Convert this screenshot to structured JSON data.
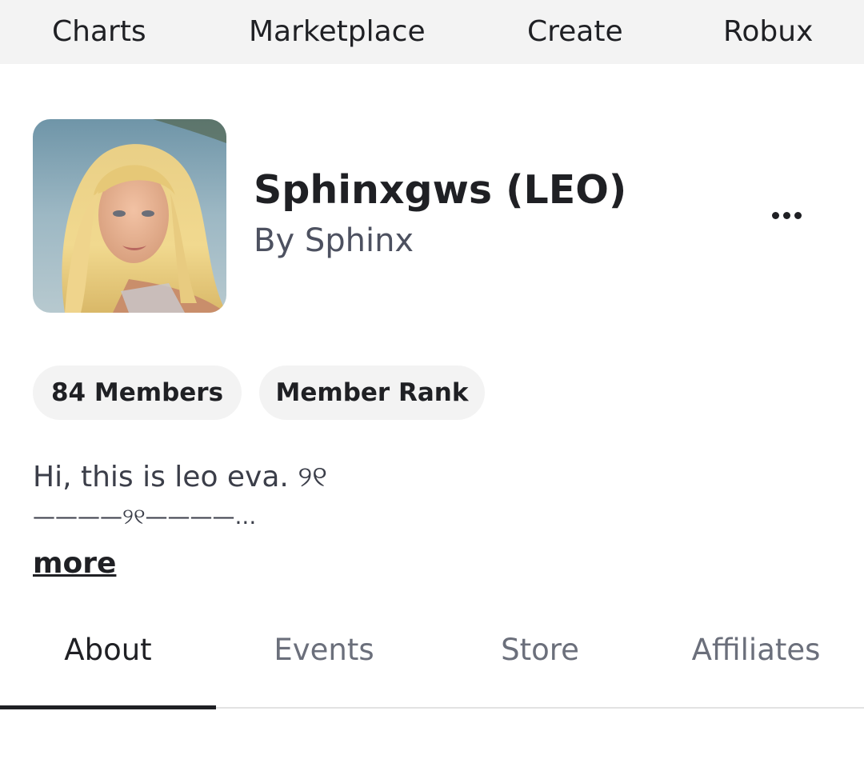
{
  "nav": {
    "charts": "Charts",
    "marketplace": "Marketplace",
    "create": "Create",
    "robux": "Robux"
  },
  "group": {
    "name": "Sphinxgws (LEO)",
    "owner": "By Sphinx",
    "members_label": "84 Members",
    "rank_label": "Member Rank",
    "description_line1": "Hi, this is leo eva.  ୨୧",
    "description_line2": "————୨୧————...",
    "more_label": "more",
    "avatar_icon": "group-avatar-photo"
  },
  "tabs": [
    {
      "label": "About",
      "active": true
    },
    {
      "label": "Events",
      "active": false
    },
    {
      "label": "Store",
      "active": false
    },
    {
      "label": "Affiliates",
      "active": false
    }
  ],
  "colors": {
    "nav_background": "#f3f3f3",
    "text_primary": "#1f2024",
    "text_secondary": "#4d5160",
    "tab_inactive": "#6b6f7b",
    "pill_background": "#f3f3f3"
  }
}
